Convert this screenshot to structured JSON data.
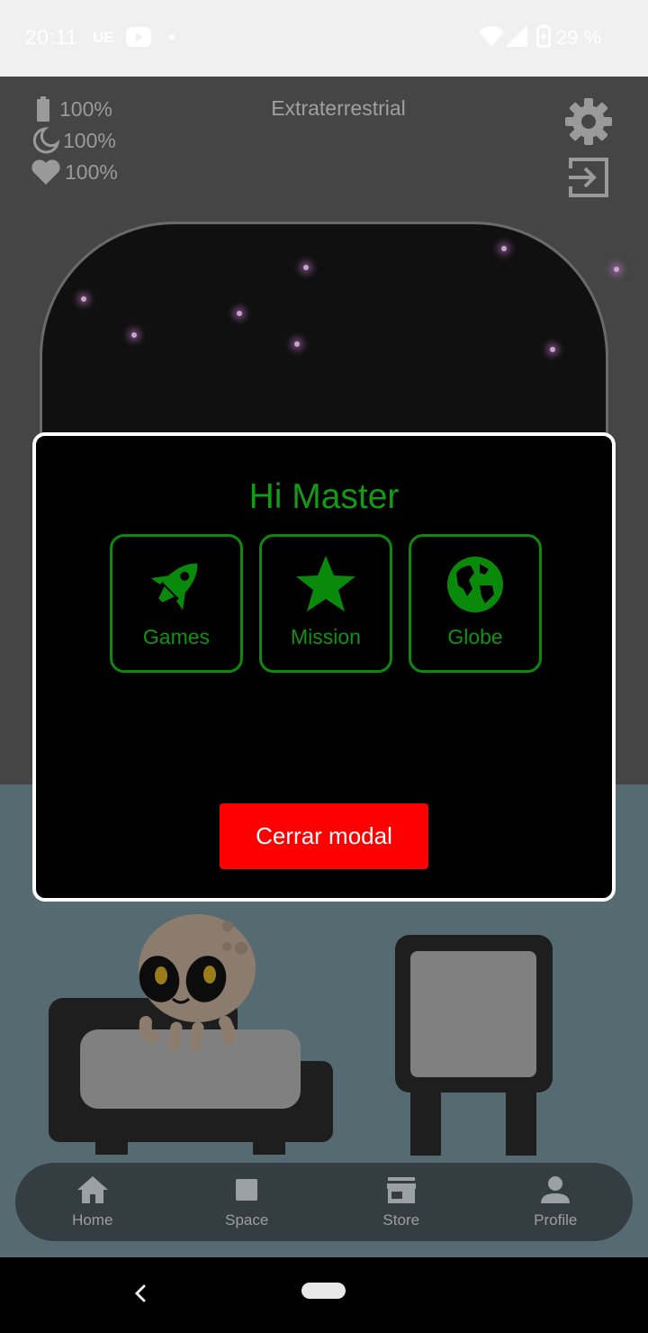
{
  "status_bar": {
    "time": "20:11",
    "carrier_badge": "UE",
    "battery_percent": "29 %",
    "icons": [
      "youtube-icon",
      "notification-dot-icon",
      "wifi-icon",
      "signal-icon",
      "battery-icon"
    ]
  },
  "header": {
    "title": "Extraterrestrial",
    "stats": [
      {
        "icon": "battery-icon",
        "value": "100%"
      },
      {
        "icon": "moon-icon",
        "value": "100%"
      },
      {
        "icon": "heart-icon",
        "value": "100%"
      }
    ],
    "settings_icon": "gear-icon",
    "logout_icon": "logout-icon"
  },
  "modal": {
    "title": "Hi Master",
    "options": [
      {
        "label": "Games",
        "icon": "rocket-icon"
      },
      {
        "label": "Mission",
        "icon": "star-icon"
      },
      {
        "label": "Globe",
        "icon": "globe-icon"
      }
    ],
    "close_label": "Cerrar modal"
  },
  "bottom_nav": {
    "items": [
      {
        "label": "Home",
        "icon": "home-icon"
      },
      {
        "label": "Space",
        "icon": "square-icon"
      },
      {
        "label": "Store",
        "icon": "store-icon"
      },
      {
        "label": "Profile",
        "icon": "person-icon"
      }
    ]
  },
  "colors": {
    "accent_green": "#109310",
    "close_button": "#ff0000",
    "app_background": "#454545",
    "floor": "#566b71",
    "nav_bar": "#343d42"
  }
}
